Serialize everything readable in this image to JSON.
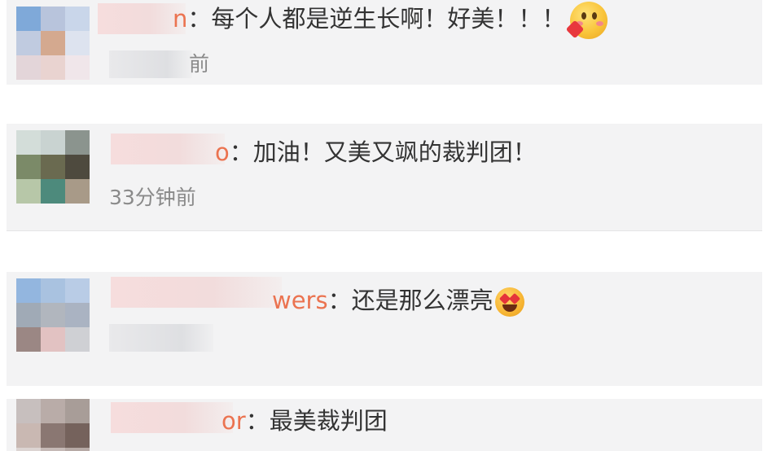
{
  "comments": [
    {
      "avatar_colors": [
        "#7fa9d9",
        "#b8c4dc",
        "#c9d6ea",
        "#c0cbe0",
        "#d4a98f",
        "#dde3ef",
        "#e3d5d9",
        "#e9d3d0",
        "#f0e6ea"
      ],
      "name_visible": "n",
      "text": "每个人都是逆生长啊！好美！！！",
      "emoji": "blush-heart-emoji",
      "time_visible": "前"
    },
    {
      "avatar_colors": [
        "#d3ddd9",
        "#c9d3d1",
        "#8b948e",
        "#7b8a68",
        "#6a6a50",
        "#4e4a3e",
        "#b7c7a8",
        "#4d8a7c",
        "#a89a88"
      ],
      "name_visible": "o",
      "text": "加油！又美又飒的裁判团！",
      "emoji": "",
      "time_visible": "33分钟前"
    },
    {
      "avatar_colors": [
        "#93b6df",
        "#a9c2e0",
        "#b9cce6",
        "#a0aab6",
        "#b1b6be",
        "#aab3c2",
        "#9b8784",
        "#e2c2c2",
        "#cfd0d4"
      ],
      "name_visible": "wers",
      "text": "还是那么漂亮",
      "emoji": "heart-eyes-emoji",
      "time_visible": ""
    },
    {
      "avatar_colors": [
        "#c7bfbe",
        "#b9aca8",
        "#a89d98",
        "#c9b8b2",
        "#8a7772",
        "#75625c",
        "#dcd4d2",
        "#c5b9b6",
        "#b6a9a5"
      ],
      "name_visible": "or",
      "text": "最美裁判团",
      "emoji": "",
      "time_visible": ""
    }
  ],
  "separator": "：",
  "colors": {
    "row_bg": "#f3f3f4",
    "name_link": "#eb7350",
    "text": "#333333",
    "time": "#8a8a8a"
  }
}
